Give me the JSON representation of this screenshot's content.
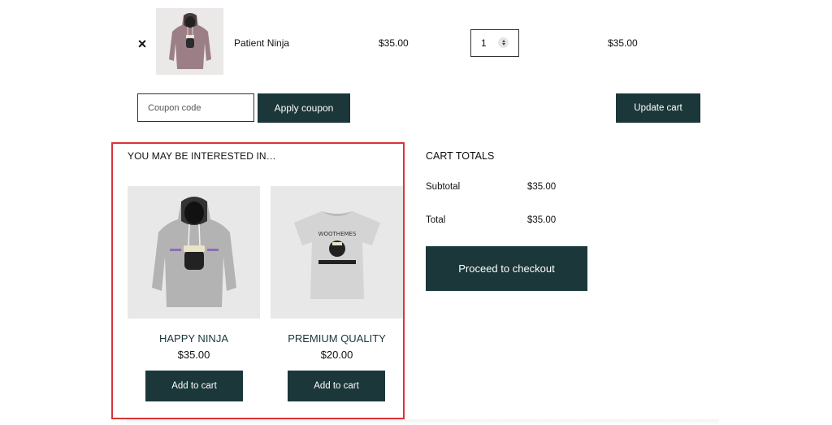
{
  "cart": {
    "item": {
      "remove_symbol": "×",
      "name": "Patient Ninja",
      "price": "$35.00",
      "quantity": "1",
      "subtotal": "$35.00",
      "image_icon": "hoodie-icon"
    },
    "coupon_placeholder": "Coupon code",
    "apply_coupon_label": "Apply coupon",
    "update_cart_label": "Update cart"
  },
  "cross_sells": {
    "title": "YOU MAY BE INTERESTED IN…",
    "products": [
      {
        "name": "HAPPY NINJA",
        "price": "$35.00",
        "button": "Add to cart",
        "image_icon": "hoodie-icon"
      },
      {
        "name": "PREMIUM QUALITY",
        "price": "$20.00",
        "button": "Add to cart",
        "image_icon": "tshirt-icon"
      }
    ]
  },
  "totals": {
    "title": "CART TOTALS",
    "subtotal_label": "Subtotal",
    "subtotal_value": "$35.00",
    "total_label": "Total",
    "total_value": "$35.00",
    "checkout_label": "Proceed to checkout"
  },
  "colors": {
    "button_bg": "#1b3739",
    "highlight_border": "#d9343b",
    "product_name": "#1b3739"
  }
}
